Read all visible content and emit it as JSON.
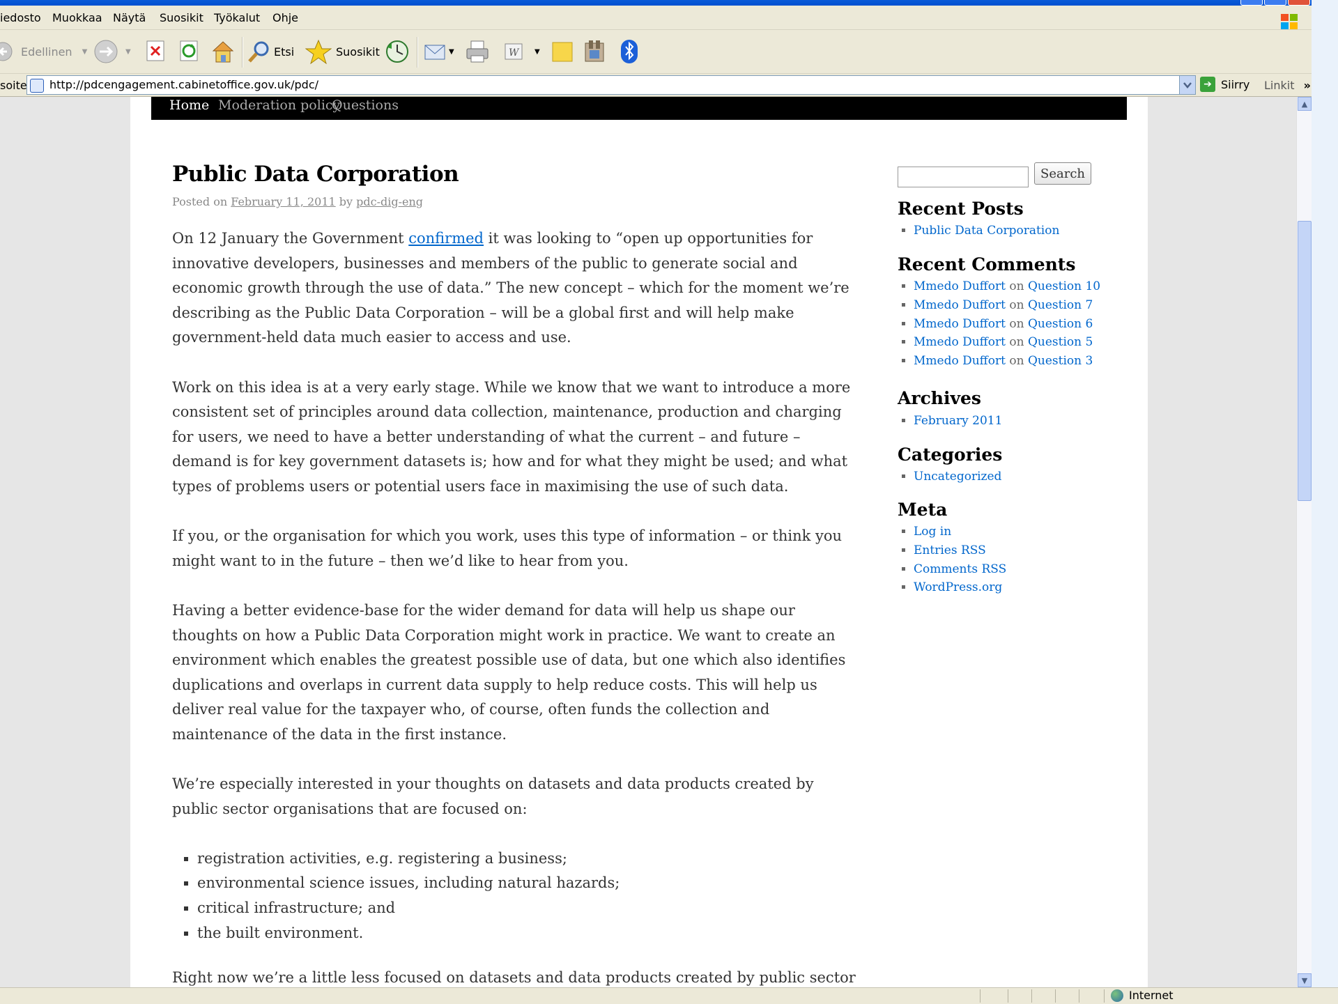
{
  "browser": {
    "menu": [
      "iedosto",
      "Muokkaa",
      "Näytä",
      "Suosikit",
      "Työkalut",
      "Ohje"
    ],
    "toolbar": {
      "back_label": "Edellinen",
      "search_label": "Etsi",
      "favorites_label": "Suosikit"
    },
    "address": {
      "label": "soite",
      "url": "http://pdcengagement.cabinetoffice.gov.uk/pdc/",
      "go_label": "Siirry",
      "links_label": "Linkit"
    },
    "status": {
      "zone": "Internet"
    }
  },
  "site": {
    "nav": [
      "Home",
      "Moderation policy",
      "Questions"
    ]
  },
  "post": {
    "title": "Public Data Corporation",
    "meta_prefix": "Posted on",
    "date": "February 11, 2011",
    "meta_by": "by",
    "author": "pdc-dig-eng",
    "p1_a": "On 12 January the Government ",
    "p1_link": "confirmed",
    "p1_b": " it was looking to “open up opportunities for innovative developers, businesses and members of the public to generate social and economic growth through the use of data.” The new concept – which for the moment we’re describing as the Public Data Corporation – will be a global first and will help make government-held data much easier to access and use.",
    "p2": "Work on this idea is at a very early stage. While we know that we want to introduce a more consistent set of principles around data collection, maintenance, production and charging for users, we need to have a better understanding of what the current – and future – demand is for key government datasets is; how and for what they might be used; and what types of problems users  or potential users face in maximising the use of such data.",
    "p3": "If you, or the organisation for which you work, uses this type of information – or think you might want to in the future – then we’d like to hear from you.",
    "p4": "Having a better evidence-base for the wider demand for data will help us shape our thoughts on how a Public Data Corporation might work in practice. We want to create an environment which enables the greatest possible use of data, but one which also identifies duplications and overlaps in current data supply to help reduce costs. This will help us deliver real value for the taxpayer who, of course, often funds the collection and maintenance of the data in the first instance.",
    "p5": "We’re especially interested in your thoughts on datasets and data products created by public sector organisations that are focused on:",
    "bullets": [
      "registration activities, e.g. registering a business;",
      "environmental science issues, including natural hazards;",
      "critical infrastructure; and",
      "the built environment."
    ],
    "p6_clipped": "Right now we’re a little less focused on datasets and data products created by public sector"
  },
  "sidebar": {
    "search_button": "Search",
    "recent_posts_title": "Recent Posts",
    "recent_posts": [
      "Public Data Corporation"
    ],
    "recent_comments_title": "Recent Comments",
    "comment_on": "on",
    "recent_comments": [
      {
        "author": "Mmedo Duffort",
        "post": "Question 10"
      },
      {
        "author": "Mmedo Duffort",
        "post": "Question 7"
      },
      {
        "author": "Mmedo Duffort",
        "post": "Question 6"
      },
      {
        "author": "Mmedo Duffort",
        "post": "Question 5"
      },
      {
        "author": "Mmedo Duffort",
        "post": "Question 3"
      }
    ],
    "archives_title": "Archives",
    "archives": [
      "February 2011"
    ],
    "categories_title": "Categories",
    "categories": [
      "Uncategorized"
    ],
    "meta_title": "Meta",
    "meta_links": [
      "Log in",
      "Entries RSS",
      "Comments RSS",
      "WordPress.org"
    ]
  },
  "colors": {
    "link": "#0066cc",
    "nav_bg": "#000000",
    "chrome": "#ece9d8"
  }
}
